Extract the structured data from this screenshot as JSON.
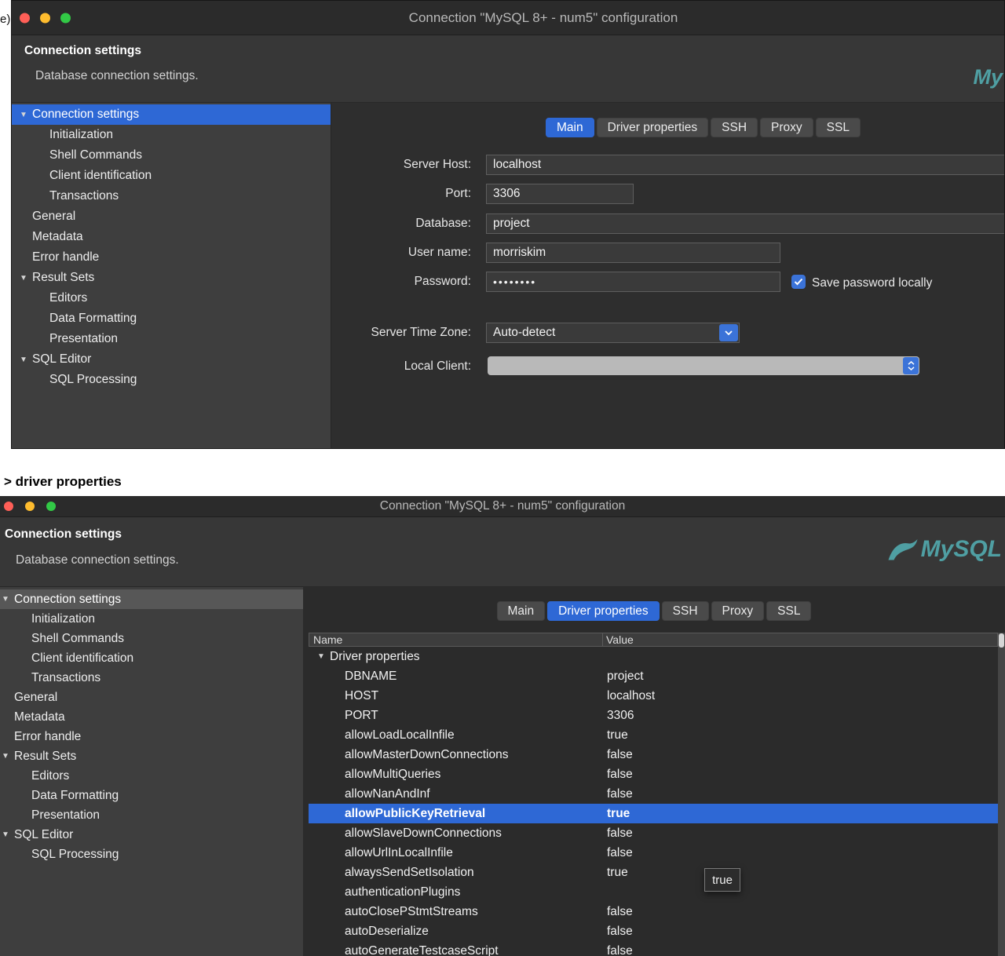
{
  "margin_note": "e)",
  "divider_label": "> driver properties",
  "window_title": "Connection \"MySQL 8+ - num5\" configuration",
  "header": {
    "title": "Connection settings",
    "subtitle": "Database connection settings.",
    "logo_text_partial": "My",
    "logo_text": "MySQL"
  },
  "tabs": [
    "Main",
    "Driver properties",
    "SSH",
    "Proxy",
    "SSL"
  ],
  "sidebar": {
    "items": [
      {
        "label": "Connection settings",
        "level": 0,
        "expandable": true,
        "selected": true
      },
      {
        "label": "Initialization",
        "level": 1
      },
      {
        "label": "Shell Commands",
        "level": 1
      },
      {
        "label": "Client identification",
        "level": 1
      },
      {
        "label": "Transactions",
        "level": 1
      },
      {
        "label": "General",
        "level": 0
      },
      {
        "label": "Metadata",
        "level": 0
      },
      {
        "label": "Error handle",
        "level": 0
      },
      {
        "label": "Result Sets",
        "level": 0,
        "expandable": true
      },
      {
        "label": "Editors",
        "level": 1
      },
      {
        "label": "Data Formatting",
        "level": 1
      },
      {
        "label": "Presentation",
        "level": 1
      },
      {
        "label": "SQL Editor",
        "level": 0,
        "expandable": true
      },
      {
        "label": "SQL Processing",
        "level": 1
      }
    ]
  },
  "dialog_top": {
    "active_tab": "Main",
    "form": {
      "server_host_label": "Server Host:",
      "server_host_value": "localhost",
      "port_label": "Port:",
      "port_value": "3306",
      "database_label": "Database:",
      "database_value": "project",
      "user_label": "User name:",
      "user_value": "morriskim",
      "password_label": "Password:",
      "password_value": "••••••••",
      "save_password_label": "Save password locally",
      "save_password_checked": true,
      "timezone_label": "Server Time Zone:",
      "timezone_value": "Auto-detect",
      "local_client_label": "Local Client:",
      "local_client_value": ""
    }
  },
  "dialog_bottom": {
    "active_tab": "Driver properties",
    "table": {
      "columns": [
        "Name",
        "Value"
      ],
      "group_label": "Driver properties",
      "rows": [
        {
          "name": "DBNAME",
          "value": "project"
        },
        {
          "name": "HOST",
          "value": "localhost"
        },
        {
          "name": "PORT",
          "value": "3306"
        },
        {
          "name": "allowLoadLocalInfile",
          "value": "true"
        },
        {
          "name": "allowMasterDownConnections",
          "value": "false"
        },
        {
          "name": "allowMultiQueries",
          "value": "false"
        },
        {
          "name": "allowNanAndInf",
          "value": "false"
        },
        {
          "name": "allowPublicKeyRetrieval",
          "value": "true",
          "selected": true
        },
        {
          "name": "allowSlaveDownConnections",
          "value": "false"
        },
        {
          "name": "allowUrlInLocalInfile",
          "value": "false"
        },
        {
          "name": "alwaysSendSetIsolation",
          "value": "true"
        },
        {
          "name": "authenticationPlugins",
          "value": ""
        },
        {
          "name": "autoClosePStmtStreams",
          "value": "false"
        },
        {
          "name": "autoDeserialize",
          "value": "false"
        },
        {
          "name": "autoGenerateTestcaseScript",
          "value": "false"
        }
      ]
    },
    "tooltip": "true"
  },
  "colors": {
    "accent_blue": "#2e68d5",
    "selected_gray": "#575757",
    "sidebar_bg": "#3e3e3e",
    "panel_bg": "#2e2e2e",
    "titlebar_bg": "#2b2b2b",
    "mysql_teal": "#4f9fa3",
    "traffic_red": "#ff5f57",
    "traffic_yellow": "#febc2e",
    "traffic_green": "#32c946"
  }
}
